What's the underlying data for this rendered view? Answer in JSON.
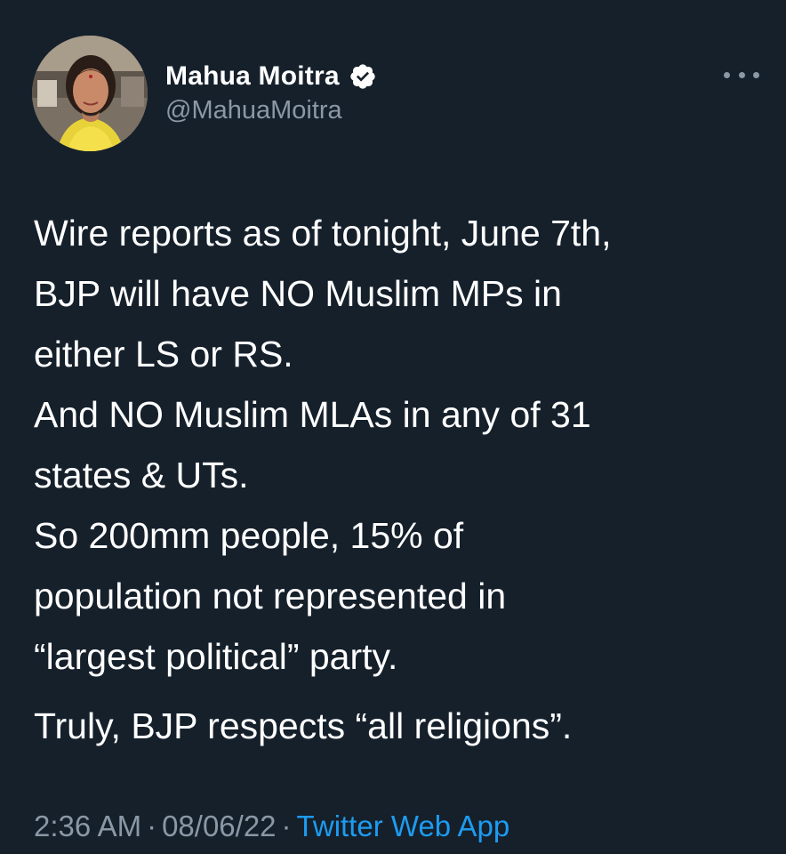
{
  "author": {
    "display_name": "Mahua Moitra",
    "handle": "@MahuaMoitra",
    "verified": true
  },
  "tweet": {
    "lines": [
      "Wire reports as of tonight, June 7th,",
      "BJP will have NO Muslim MPs in",
      "either LS or RS.",
      "And NO Muslim MLAs in any of 31",
      "states & UTs.",
      "So 200mm people, 15% of",
      "population not represented in",
      "“largest political” party."
    ],
    "closing_line": "Truly, BJP respects “all religions”."
  },
  "meta": {
    "time": "2:36 AM",
    "separator": "·",
    "date": "08/06/22",
    "source": "Twitter Web App"
  },
  "icons": {
    "verified": "verified-badge-icon",
    "more": "more-options-icon"
  },
  "colors": {
    "background": "#15202b",
    "text": "#ffffff",
    "secondary_text": "#8b98a5",
    "link": "#1d9bf0"
  }
}
